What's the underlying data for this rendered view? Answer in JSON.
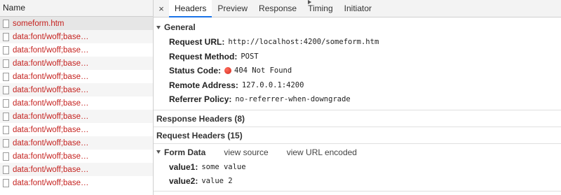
{
  "left_panel": {
    "header": "Name",
    "requests": [
      "someform.htm",
      "data:font/woff;base…",
      "data:font/woff;base…",
      "data:font/woff;base…",
      "data:font/woff;base…",
      "data:font/woff;base…",
      "data:font/woff;base…",
      "data:font/woff;base…",
      "data:font/woff;base…",
      "data:font/woff;base…",
      "data:font/woff;base…",
      "data:font/woff;base…",
      "data:font/woff;base…"
    ],
    "request_text_color": "#c5221f"
  },
  "tabs": {
    "close": "×",
    "items": [
      "Headers",
      "Preview",
      "Response",
      "Timing",
      "Initiator"
    ],
    "active": "Headers",
    "accent": "#1a73e8"
  },
  "general": {
    "title": "General",
    "request_url_label": "Request URL:",
    "request_url": "http://localhost:4200/someform.htm",
    "request_method_label": "Request Method:",
    "request_method": "POST",
    "status_code_label": "Status Code:",
    "status_code": "404 Not Found",
    "status_color": "#d12b1e",
    "remote_address_label": "Remote Address:",
    "remote_address": "127.0.0.1:4200",
    "referrer_policy_label": "Referrer Policy:",
    "referrer_policy": "no-referrer-when-downgrade"
  },
  "response_headers": {
    "title": "Response Headers (8)"
  },
  "request_headers": {
    "title": "Request Headers (15)"
  },
  "form_data": {
    "title": "Form Data",
    "view_source": "view source",
    "view_url_encoded": "view URL encoded",
    "field1_label": "value1:",
    "field1_value": "some value",
    "field2_label": "value2:",
    "field2_value": "value 2"
  }
}
